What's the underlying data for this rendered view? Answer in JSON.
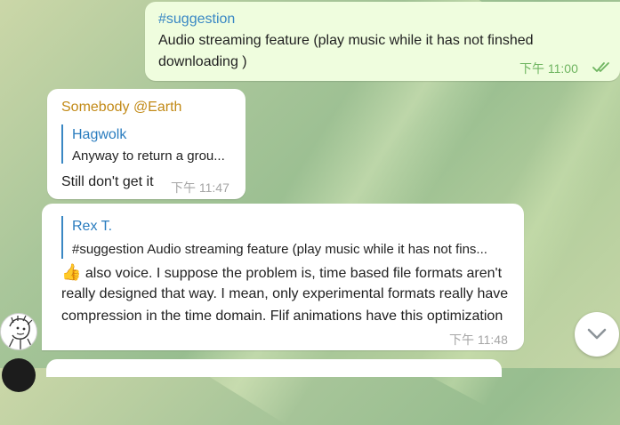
{
  "messages": [
    {
      "hashtag": "#suggestion",
      "text_line1": "Audio streaming feature (play music while it has not finshed",
      "text_line2": "downloading )",
      "time": "下午 11:00",
      "status_icon": "double-check-icon"
    },
    {
      "sender": "Somebody @Earth",
      "reply_name": "Hagwolk",
      "reply_text": "Anyway to return a grou...",
      "text": "Still don't get it",
      "time": "下午 11:47"
    },
    {
      "reply_name": "Rex T.",
      "reply_text": "#suggestion Audio streaming feature (play music while it has not fins...",
      "emoji": "👍",
      "text_line1": " also voice. I suppose the problem is, time based file formats aren't",
      "text_line2": "really designed that way. I mean, only experimental formats really have",
      "text_line3": "compression in the time domain. Flif animations have this optimization",
      "time": "下午 11:48"
    }
  ],
  "scroll_button_icon": "chevron-down-icon",
  "colors": {
    "outgoing_bubble": "#effdde",
    "incoming_bubble": "#ffffff",
    "link_blue": "#3a88c4",
    "sender_name": "#c28a17",
    "outgoing_time": "#6fb561"
  }
}
